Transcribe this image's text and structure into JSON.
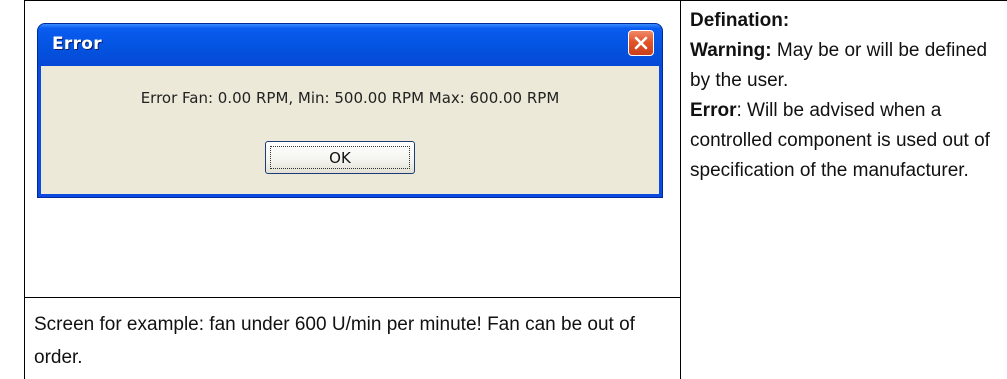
{
  "dialog": {
    "title": "Error",
    "message": "Error Fan: 0.00 RPM, Min: 500.00 RPM Max: 600.00 RPM",
    "ok_label": "OK",
    "close_icon": "close-icon"
  },
  "caption": {
    "text": "Screen for example: fan under 600 U/min per minute! Fan can be out of order."
  },
  "definition": {
    "heading": "Defination:",
    "warning_label": "Warning:",
    "warning_text": " May be or will be defined by the user.",
    "error_label": "Error",
    "error_text": ": Will be advised when a controlled component is used out of specification of the manufacturer."
  },
  "colors": {
    "titlebar": "#0556e6",
    "client": "#ece9d8",
    "close_button": "#e2542a"
  }
}
